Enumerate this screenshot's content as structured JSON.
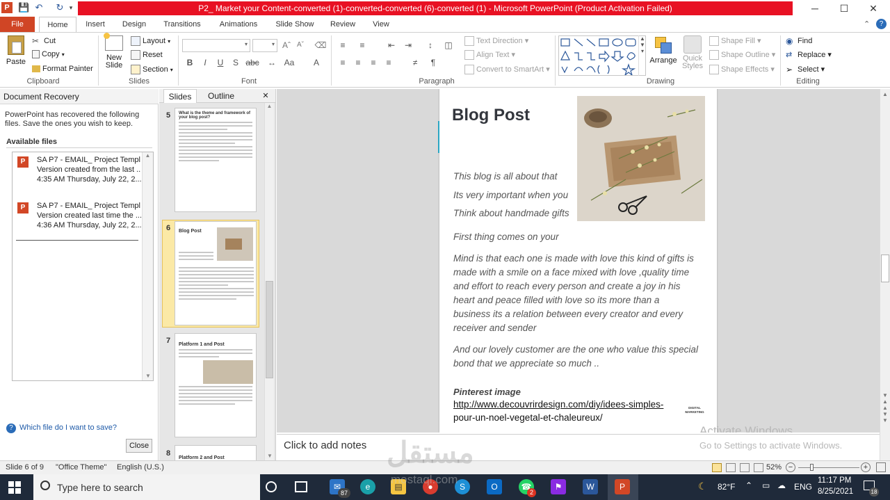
{
  "window": {
    "title": "P2_ Market your Content-converted (1)-converted-converted (6)-converted (1)  -  Microsoft PowerPoint (Product Activation Failed)",
    "minimize": "─",
    "maximize": "☐",
    "close": "✕"
  },
  "tabs": [
    "File",
    "Home",
    "Insert",
    "Design",
    "Transitions",
    "Animations",
    "Slide Show",
    "Review",
    "View"
  ],
  "ribbon": {
    "clipboard": {
      "paste": "Paste",
      "cut": "Cut",
      "copy": "Copy",
      "format_painter": "Format Painter",
      "label": "Clipboard"
    },
    "slides": {
      "new_slide": "New Slide",
      "layout": "Layout",
      "reset": "Reset",
      "section": "Section",
      "label": "Slides"
    },
    "font": {
      "label": "Font"
    },
    "paragraph": {
      "text_direction": "Text Direction",
      "align_text": "Align Text",
      "convert_smartart": "Convert to SmartArt",
      "label": "Paragraph"
    },
    "drawing": {
      "arrange": "Arrange",
      "quick_styles": "Quick Styles",
      "shape_fill": "Shape Fill",
      "shape_outline": "Shape Outline",
      "shape_effects": "Shape Effects",
      "label": "Drawing"
    },
    "editing": {
      "find": "Find",
      "replace": "Replace",
      "select": "Select",
      "label": "Editing"
    }
  },
  "recovery": {
    "title": "Document Recovery",
    "description": "PowerPoint has recovered the following files. Save the ones you wish to keep.",
    "available": "Available files",
    "files": [
      {
        "name": "SA P7 - EMAIL_ Project Templ...",
        "line2": "Version created from the last ...",
        "line3": "4:35 AM Thursday, July 22, 2..."
      },
      {
        "name": "SA P7 - EMAIL_ Project Templ...",
        "line2": "Version created last time the ...",
        "line3": "4:36 AM Thursday, July 22, 2..."
      }
    ],
    "help": "Which file do I want to save?",
    "close": "Close"
  },
  "thumbpane": {
    "tab_slides": "Slides",
    "tab_outline": "Outline",
    "close": "✕",
    "slides": [
      {
        "num": "5",
        "title": "What is the theme and framework of your blog post?"
      },
      {
        "num": "6",
        "title": "Blog Post"
      },
      {
        "num": "7",
        "title": "Platform 1 and Post"
      },
      {
        "num": "8",
        "title": "Platform 2 and Post"
      }
    ]
  },
  "slide": {
    "title": "Blog Post",
    "lines_top": [
      "This blog  is all  about  that",
      "Its very important  when  you",
      "Think  about  handmade gifts"
    ],
    "line_first": "First thing  comes on  your",
    "paragraph": "Mind  is  that  each  one is made with  love this kind of gifts is made with  a  smile on a face mixed with  love ,quality time and effort to reach every person and create a joy in his heart and peace  filled  with  love so its more than  a business   its a relation  between  every creator and every receiver and sender",
    "paragraph2": "And our lovely customer are the one who  value this special bond that we appreciate so much ..",
    "pinterest_label": "Pinterest  image",
    "link": "http://www.decouvrirdesign.com/diy/idees-simples-",
    "link2": "pour-un-noel-vegetal-et-chaleureux/",
    "logo": "DIGITAL MARKETING"
  },
  "notes": {
    "placeholder": "Click to add notes"
  },
  "activate": {
    "line1": "Activate Windows",
    "line2": "Go to Settings to activate Windows."
  },
  "status": {
    "slide": "Slide 6 of 9",
    "theme": "\"Office Theme\"",
    "lang": "English (U.S.)",
    "zoom": "52%"
  },
  "taskbar": {
    "search": "Type here to search",
    "mail_badge": "87",
    "whatsapp_badge": "2",
    "temp": "82°F",
    "lang": "ENG",
    "time": "11:17 PM",
    "date": "8/25/2021",
    "notif": "18"
  },
  "watermark": {
    "arabic": "مستقل",
    "latin": "mostaql.com"
  }
}
